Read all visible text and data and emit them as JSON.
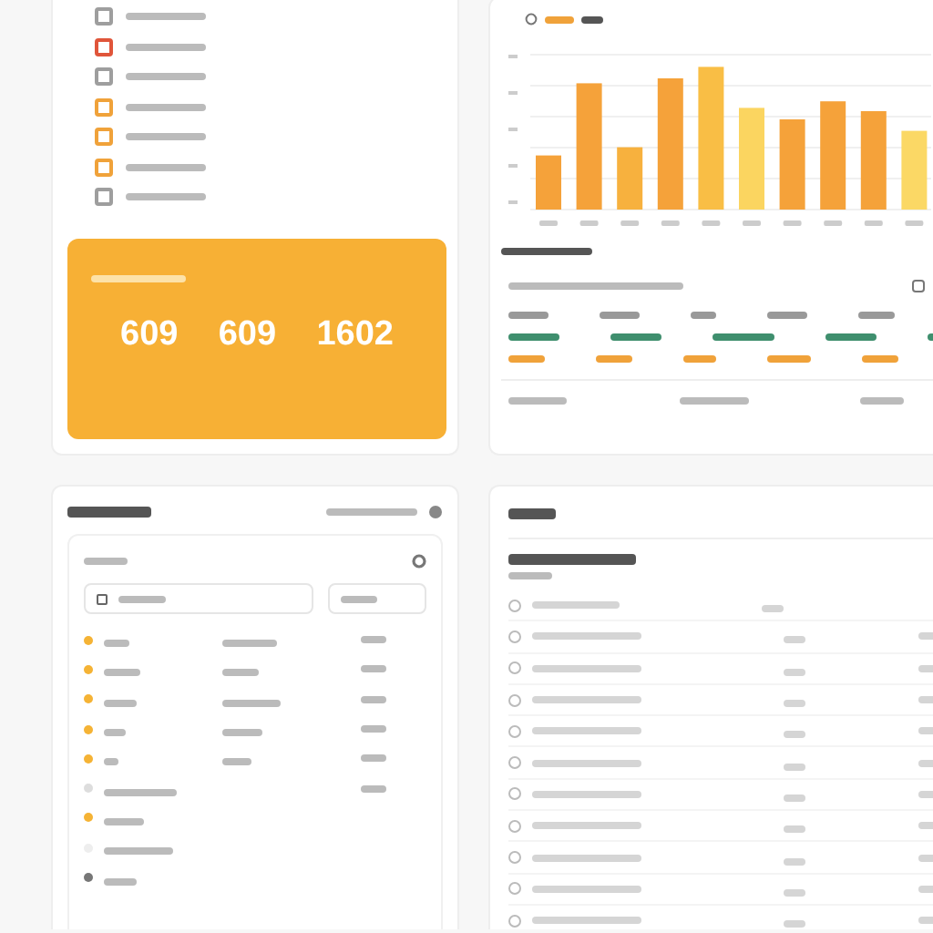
{
  "checklist": [
    {
      "color": "#9e9e9e"
    },
    {
      "color": "#e0553a"
    },
    {
      "color": "#9e9e9e"
    },
    {
      "color": "#f0a23a"
    },
    {
      "color": "#f0a23a"
    },
    {
      "color": "#f0a23a"
    },
    {
      "color": "#9e9e9e"
    }
  ],
  "stats": {
    "values": [
      "609",
      "609",
      "1602"
    ]
  },
  "table": {
    "rows": [
      {
        "color": "#3f8f6e"
      },
      {
        "color": "#f0a23a"
      }
    ]
  },
  "list": [
    {
      "color": "#f5b335"
    },
    {
      "color": "#f5b335"
    },
    {
      "color": "#f5b335"
    },
    {
      "color": "#f5b335"
    },
    {
      "color": "#f5b335"
    },
    {
      "color": "#dddddd"
    },
    {
      "color": "#f5b335"
    },
    {
      "color": "#eeeeee"
    },
    {
      "color": "#777777"
    }
  ],
  "details": [
    {
      "kind": "short"
    },
    {
      "kind": "full"
    },
    {
      "kind": "full"
    },
    {
      "kind": "full"
    },
    {
      "kind": "full"
    },
    {
      "kind": "full"
    },
    {
      "kind": "full"
    },
    {
      "kind": "full"
    },
    {
      "kind": "full"
    },
    {
      "kind": "full"
    },
    {
      "kind": "full"
    }
  ]
}
